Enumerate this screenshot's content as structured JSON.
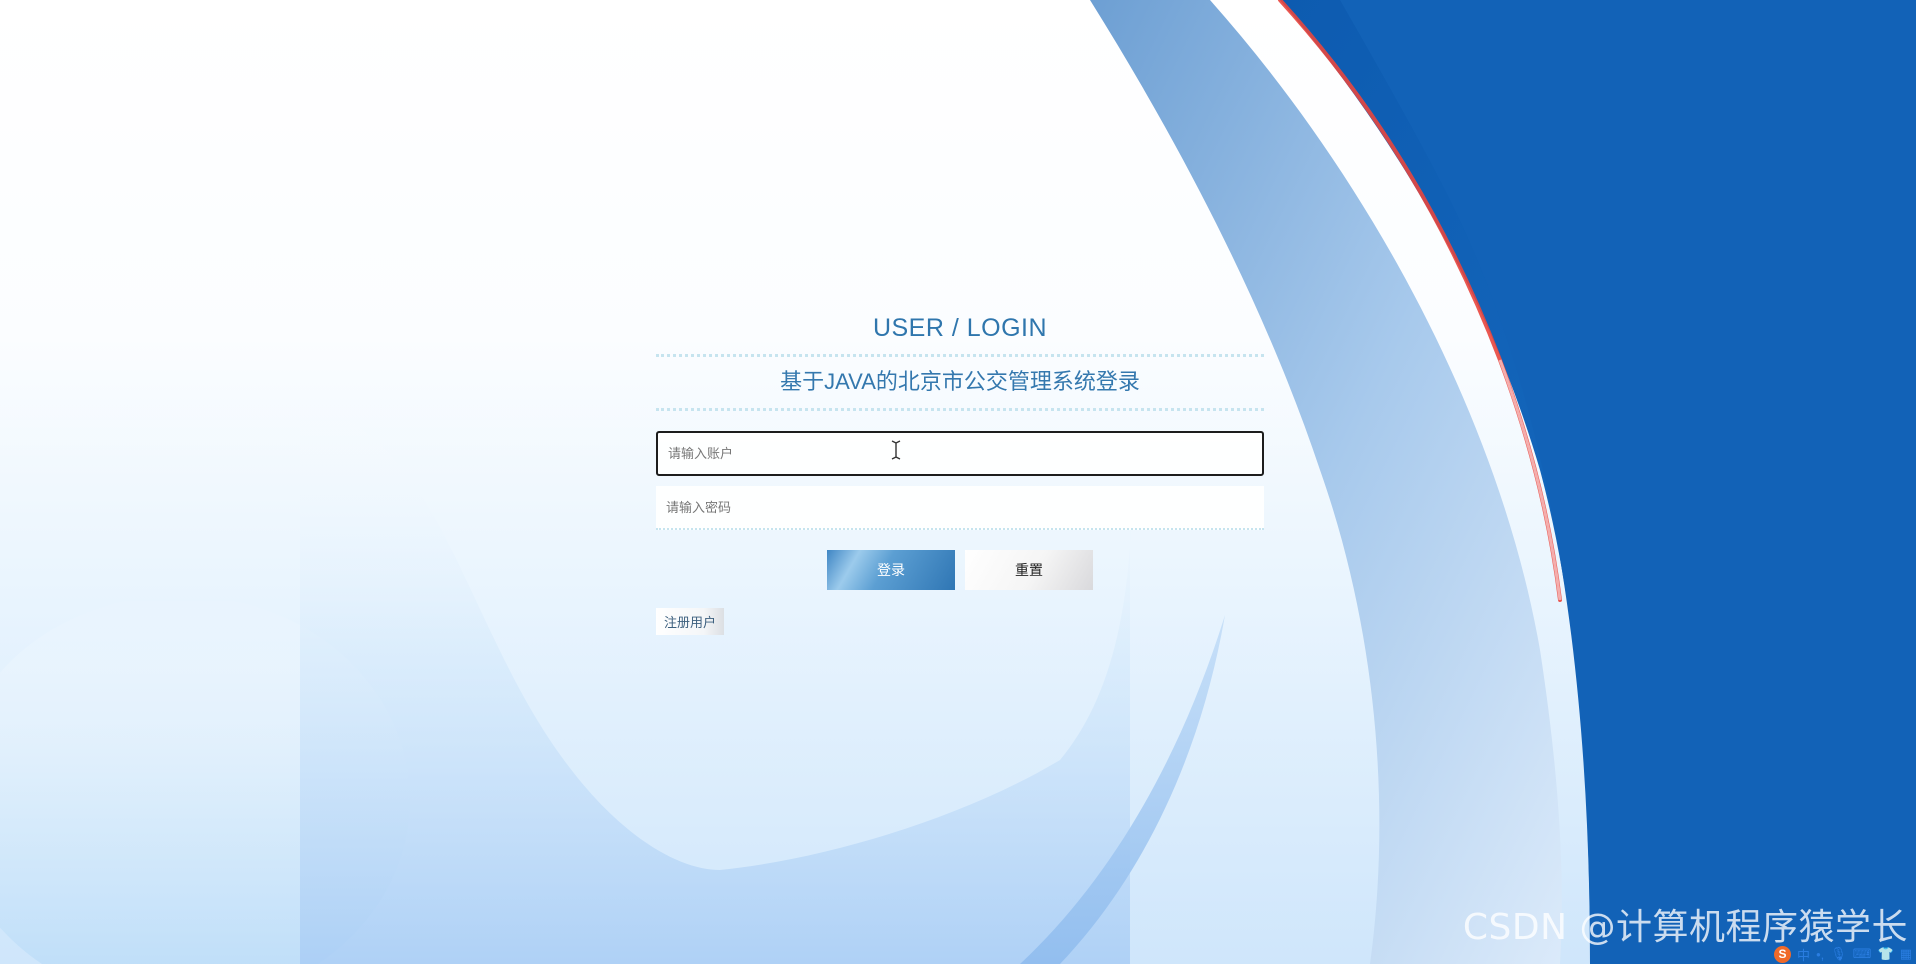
{
  "login": {
    "title": "USER / LOGIN",
    "subtitle": "基于JAVA的北京市公交管理系统登录",
    "account_placeholder": "请输入账户",
    "password_placeholder": "请输入密码",
    "login_label": "登录",
    "reset_label": "重置",
    "register_label": "注册用户"
  },
  "watermark": "CSDN @计算机程序猿学长",
  "tray": {
    "ime_logo": "S",
    "ime_mode": "中"
  },
  "colors": {
    "accent_blue": "#1260b4",
    "title_blue": "#2f76ad",
    "red_stripe": "#e8463e"
  },
  "icons": [
    "text-cursor-icon",
    "sogou-ime-icon",
    "punctuation-icon",
    "microphone-icon",
    "keyboard-icon",
    "skin-icon",
    "toolbox-icon"
  ]
}
